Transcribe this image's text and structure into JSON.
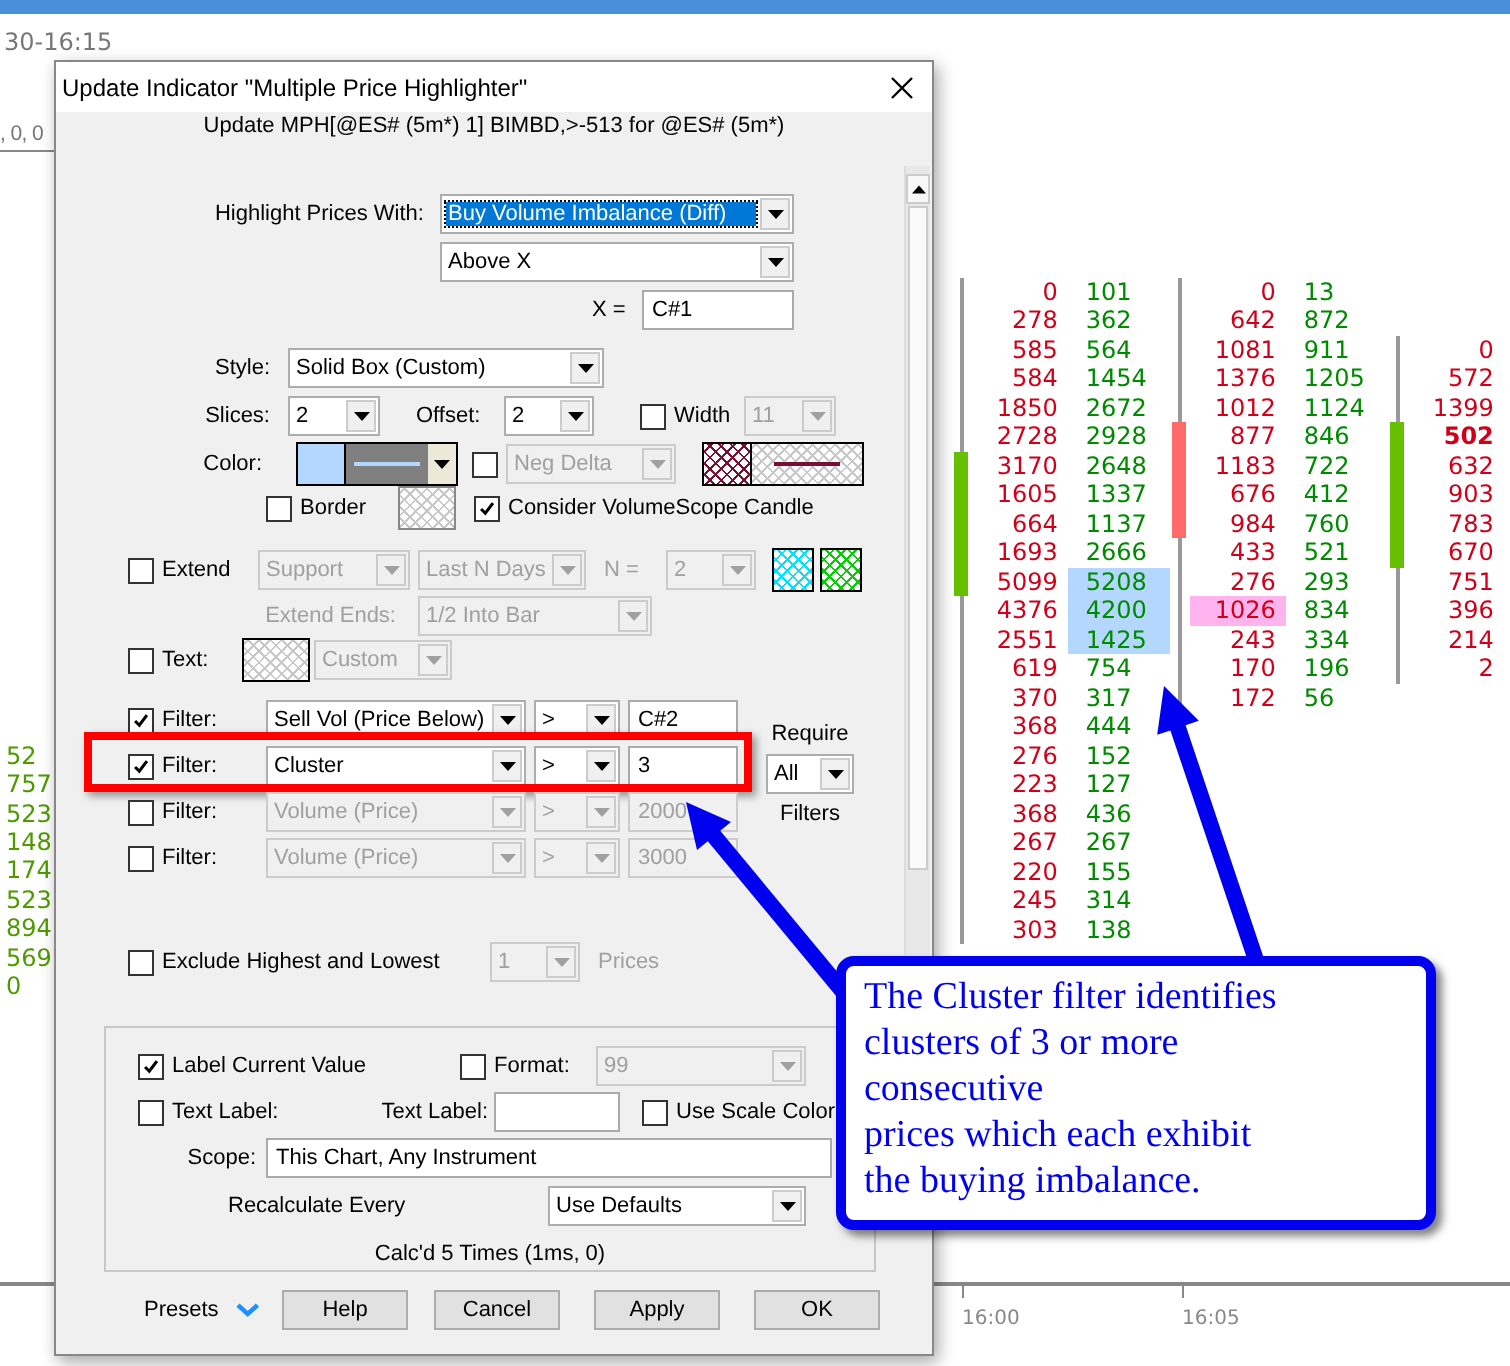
{
  "header": {
    "time_range": "30-16:15",
    "values": ", 0, 0"
  },
  "left_values": [
    "52",
    "757",
    "523",
    "148",
    "174",
    "523",
    "894",
    "569",
    "0"
  ],
  "footprint": {
    "columns": [
      {
        "kind": "up",
        "rows": [
          {
            "kind": "volume",
            "bid": "0",
            "ask": "101",
            "bid_highlighted": false,
            "ask_highlighted": false,
            "bold": false,
            "body": false
          },
          {
            "kind": "volume",
            "bid": "278",
            "ask": "362",
            "bid_highlighted": false,
            "ask_highlighted": false,
            "bold": false,
            "body": false
          },
          {
            "kind": "volume",
            "bid": "585",
            "ask": "564",
            "bid_highlighted": false,
            "ask_highlighted": false,
            "bold": false,
            "body": false
          },
          {
            "kind": "volume",
            "bid": "584",
            "ask": "1454",
            "bid_highlighted": false,
            "ask_highlighted": false,
            "bold": false,
            "body": false
          },
          {
            "kind": "volume",
            "bid": "1850",
            "ask": "2672",
            "bid_highlighted": false,
            "ask_highlighted": false,
            "bold": false,
            "body": false
          },
          {
            "kind": "volume",
            "bid": "2728",
            "ask": "2928",
            "bid_highlighted": false,
            "ask_highlighted": false,
            "bold": false,
            "body": false
          },
          {
            "kind": "volume",
            "bid": "3170",
            "ask": "2648",
            "bid_highlighted": false,
            "ask_highlighted": false,
            "bold": false,
            "body": true
          },
          {
            "kind": "volume",
            "bid": "1605",
            "ask": "1337",
            "bid_highlighted": false,
            "ask_highlighted": false,
            "bold": false,
            "body": true
          },
          {
            "kind": "volume",
            "bid": "664",
            "ask": "1137",
            "bid_highlighted": false,
            "ask_highlighted": false,
            "bold": false,
            "body": true
          },
          {
            "kind": "volume",
            "bid": "1693",
            "ask": "2666",
            "bid_highlighted": false,
            "ask_highlighted": false,
            "bold": false,
            "body": true
          },
          {
            "kind": "volume",
            "bid": "5099",
            "ask": "5208",
            "bid_highlighted": false,
            "ask_highlighted": true,
            "bold": false,
            "body": true
          },
          {
            "kind": "volume",
            "bid": "4376",
            "ask": "4200",
            "bid_highlighted": false,
            "ask_highlighted": true,
            "bold": false,
            "body": false
          },
          {
            "kind": "volume",
            "bid": "2551",
            "ask": "1425",
            "bid_highlighted": false,
            "ask_highlighted": true,
            "bold": false,
            "body": false
          },
          {
            "kind": "volume",
            "bid": "619",
            "ask": "754",
            "bid_highlighted": false,
            "ask_highlighted": false,
            "bold": false,
            "body": false
          },
          {
            "kind": "volume",
            "bid": "370",
            "ask": "317",
            "bid_highlighted": false,
            "ask_highlighted": false,
            "bold": false,
            "body": false
          },
          {
            "kind": "volume",
            "bid": "368",
            "ask": "444",
            "bid_highlighted": false,
            "ask_highlighted": false,
            "bold": false,
            "body": false
          },
          {
            "kind": "volume",
            "bid": "276",
            "ask": "152",
            "bid_highlighted": false,
            "ask_highlighted": false,
            "bold": false,
            "body": false
          },
          {
            "kind": "volume",
            "bid": "223",
            "ask": "127",
            "bid_highlighted": false,
            "ask_highlighted": false,
            "bold": false,
            "body": false
          },
          {
            "kind": "volume",
            "bid": "368",
            "ask": "436",
            "bid_highlighted": false,
            "ask_highlighted": false,
            "bold": false,
            "body": false
          },
          {
            "kind": "volume",
            "bid": "267",
            "ask": "267",
            "bid_highlighted": false,
            "ask_highlighted": false,
            "bold": false,
            "body": false
          },
          {
            "kind": "volume",
            "bid": "220",
            "ask": "155",
            "bid_highlighted": false,
            "ask_highlighted": false,
            "bold": false,
            "body": false
          },
          {
            "kind": "volume",
            "bid": "245",
            "ask": "314",
            "bid_highlighted": false,
            "ask_highlighted": false,
            "bold": false,
            "body": false
          },
          {
            "kind": "volume",
            "bid": "303",
            "ask": "138",
            "bid_highlighted": false,
            "ask_highlighted": false,
            "bold": false,
            "body": false
          }
        ]
      },
      {
        "kind": "down",
        "rows": [
          {
            "kind": "volume",
            "bid": "0",
            "ask": "13",
            "bid_highlighted": false,
            "ask_highlighted": false,
            "bold": false,
            "body": false
          },
          {
            "kind": "volume",
            "bid": "642",
            "ask": "872",
            "bid_highlighted": false,
            "ask_highlighted": false,
            "bold": false,
            "body": false
          },
          {
            "kind": "volume",
            "bid": "1081",
            "ask": "911",
            "bid_highlighted": false,
            "ask_highlighted": false,
            "bold": false,
            "body": false
          },
          {
            "kind": "volume",
            "bid": "1376",
            "ask": "1205",
            "bid_highlighted": false,
            "ask_highlighted": false,
            "bold": false,
            "body": false
          },
          {
            "kind": "volume",
            "bid": "1012",
            "ask": "1124",
            "bid_highlighted": false,
            "ask_highlighted": false,
            "bold": false,
            "body": false
          },
          {
            "kind": "volume",
            "bid": "877",
            "ask": "846",
            "bid_highlighted": false,
            "ask_highlighted": false,
            "bold": false,
            "body": true
          },
          {
            "kind": "volume",
            "bid": "1183",
            "ask": "722",
            "bid_highlighted": false,
            "ask_highlighted": false,
            "bold": false,
            "body": true
          },
          {
            "kind": "volume",
            "bid": "676",
            "ask": "412",
            "bid_highlighted": false,
            "ask_highlighted": false,
            "bold": false,
            "body": true
          },
          {
            "kind": "volume",
            "bid": "984",
            "ask": "760",
            "bid_highlighted": false,
            "ask_highlighted": false,
            "bold": false,
            "body": true
          },
          {
            "kind": "volume",
            "bid": "433",
            "ask": "521",
            "bid_highlighted": false,
            "ask_highlighted": false,
            "bold": false,
            "body": false
          },
          {
            "kind": "volume",
            "bid": "276",
            "ask": "293",
            "bid_highlighted": false,
            "ask_highlighted": false,
            "bold": false,
            "body": false
          },
          {
            "kind": "volume",
            "bid": "1026",
            "ask": "834",
            "bid_highlighted": true,
            "ask_highlighted": false,
            "bold": false,
            "body": false
          },
          {
            "kind": "volume",
            "bid": "243",
            "ask": "334",
            "bid_highlighted": false,
            "ask_highlighted": false,
            "bold": false,
            "body": false
          },
          {
            "kind": "volume",
            "bid": "170",
            "ask": "196",
            "bid_highlighted": false,
            "ask_highlighted": false,
            "bold": false,
            "body": false
          },
          {
            "kind": "volume",
            "bid": "172",
            "ask": "56",
            "bid_highlighted": false,
            "ask_highlighted": false,
            "bold": false,
            "body": false
          }
        ]
      },
      {
        "kind": "up",
        "rows": [
          {
            "kind": "empty"
          },
          {
            "kind": "empty"
          },
          {
            "kind": "volume",
            "bid": "0",
            "bid_highlighted": false,
            "bold": false,
            "body": false
          },
          {
            "kind": "volume",
            "bid": "572",
            "bid_highlighted": false,
            "bold": false,
            "body": false
          },
          {
            "kind": "volume",
            "bid": "1399",
            "bid_highlighted": false,
            "bold": false,
            "body": false
          },
          {
            "kind": "volume",
            "bid": "502",
            "bid_highlighted": false,
            "bold": true,
            "body": true
          },
          {
            "kind": "volume",
            "bid": "632",
            "bid_highlighted": false,
            "bold": false,
            "body": true
          },
          {
            "kind": "volume",
            "bid": "903",
            "bid_highlighted": false,
            "bold": false,
            "body": true
          },
          {
            "kind": "volume",
            "bid": "783",
            "bid_highlighted": false,
            "bold": false,
            "body": true
          },
          {
            "kind": "volume",
            "bid": "670",
            "bid_highlighted": false,
            "bold": false,
            "body": true
          },
          {
            "kind": "volume",
            "bid": "751",
            "bid_highlighted": false,
            "bold": false,
            "body": false
          },
          {
            "kind": "volume",
            "bid": "396",
            "bid_highlighted": false,
            "bold": false,
            "body": false
          },
          {
            "kind": "volume",
            "bid": "214",
            "bid_highlighted": false,
            "bold": false,
            "body": false
          },
          {
            "kind": "volume",
            "bid": "2",
            "bid_highlighted": false,
            "bold": false,
            "body": false
          }
        ]
      }
    ]
  },
  "time_axis": [
    "16:00",
    "16:05"
  ],
  "dialog": {
    "title": "Update Indicator \"Multiple Price Highlighter\"",
    "subtitle": "Update MPH[@ES# (5m*) 1] BIMBD,>-513 for @ES# (5m*)",
    "highlight": {
      "label": "Highlight Prices With:",
      "value": "Buy Volume Imbalance (Diff)",
      "focused": true,
      "condition": "Above X",
      "x_label": "X =",
      "x_value": "C#1"
    },
    "style": {
      "label": "Style:",
      "value": "Solid Box (Custom)"
    },
    "slices": {
      "label": "Slices:",
      "value": "2"
    },
    "offset": {
      "label": "Offset:",
      "value": "2"
    },
    "width": {
      "label": "Width",
      "checked": false,
      "value": "11"
    },
    "color": {
      "label": "Color:"
    },
    "neg_delta": {
      "checked": false,
      "value": "Neg Delta"
    },
    "border": {
      "label": "Border",
      "checked": false
    },
    "consider_candle": {
      "label": "Consider VolumeScope Candle",
      "checked": true
    },
    "extend": {
      "label": "Extend",
      "checked": false,
      "type": "Support",
      "range": "Last N Days",
      "n_label": "N =",
      "n": "2",
      "ends_label": "Extend Ends:",
      "ends": "1/2 Into Bar"
    },
    "text": {
      "label": "Text:",
      "checked": false,
      "value": "Custom"
    },
    "filters": [
      {
        "label": "Filter:",
        "checked": true,
        "field": "Sell Vol (Price Below)",
        "operator": ">",
        "value": "C#2",
        "annotated": false
      },
      {
        "label": "Filter:",
        "checked": true,
        "field": "Cluster",
        "operator": ">",
        "value": "3",
        "annotated": true
      },
      {
        "label": "Filter:",
        "checked": false,
        "field": "Volume (Price)",
        "operator": ">",
        "value": "2000",
        "annotated": false
      },
      {
        "label": "Filter:",
        "checked": false,
        "field": "Volume (Price)",
        "operator": ">",
        "value": "3000",
        "annotated": false
      }
    ],
    "require": {
      "label": "Require",
      "value": "All",
      "suffix": "Filters"
    },
    "exclude": {
      "label": "Exclude Highest and Lowest",
      "checked": false,
      "count": "1",
      "unit": "Prices"
    },
    "label_current": {
      "label": "Label Current Value",
      "checked": true
    },
    "format": {
      "label": "Format:",
      "checked": false,
      "value": "99"
    },
    "text_label": {
      "label": "Text Label:",
      "checked": false,
      "field_label": "Text Label:"
    },
    "use_scale_color": {
      "label": "Use Scale Color",
      "checked": false
    },
    "scope": {
      "label": "Scope:",
      "value": "This Chart, Any Instrument"
    },
    "recalculate": {
      "label": "Recalculate Every",
      "value": "Use Defaults"
    },
    "calc_status": "Calc'd 5 Times (1ms, 0)",
    "presets": "Presets",
    "buttons": [
      "Help",
      "Cancel",
      "Apply",
      "OK"
    ]
  },
  "callout": {
    "text": "The Cluster filter identifies\nclusters of 3 or more\nconsecutive\nprices which each exhibit\nthe buying imbalance."
  }
}
